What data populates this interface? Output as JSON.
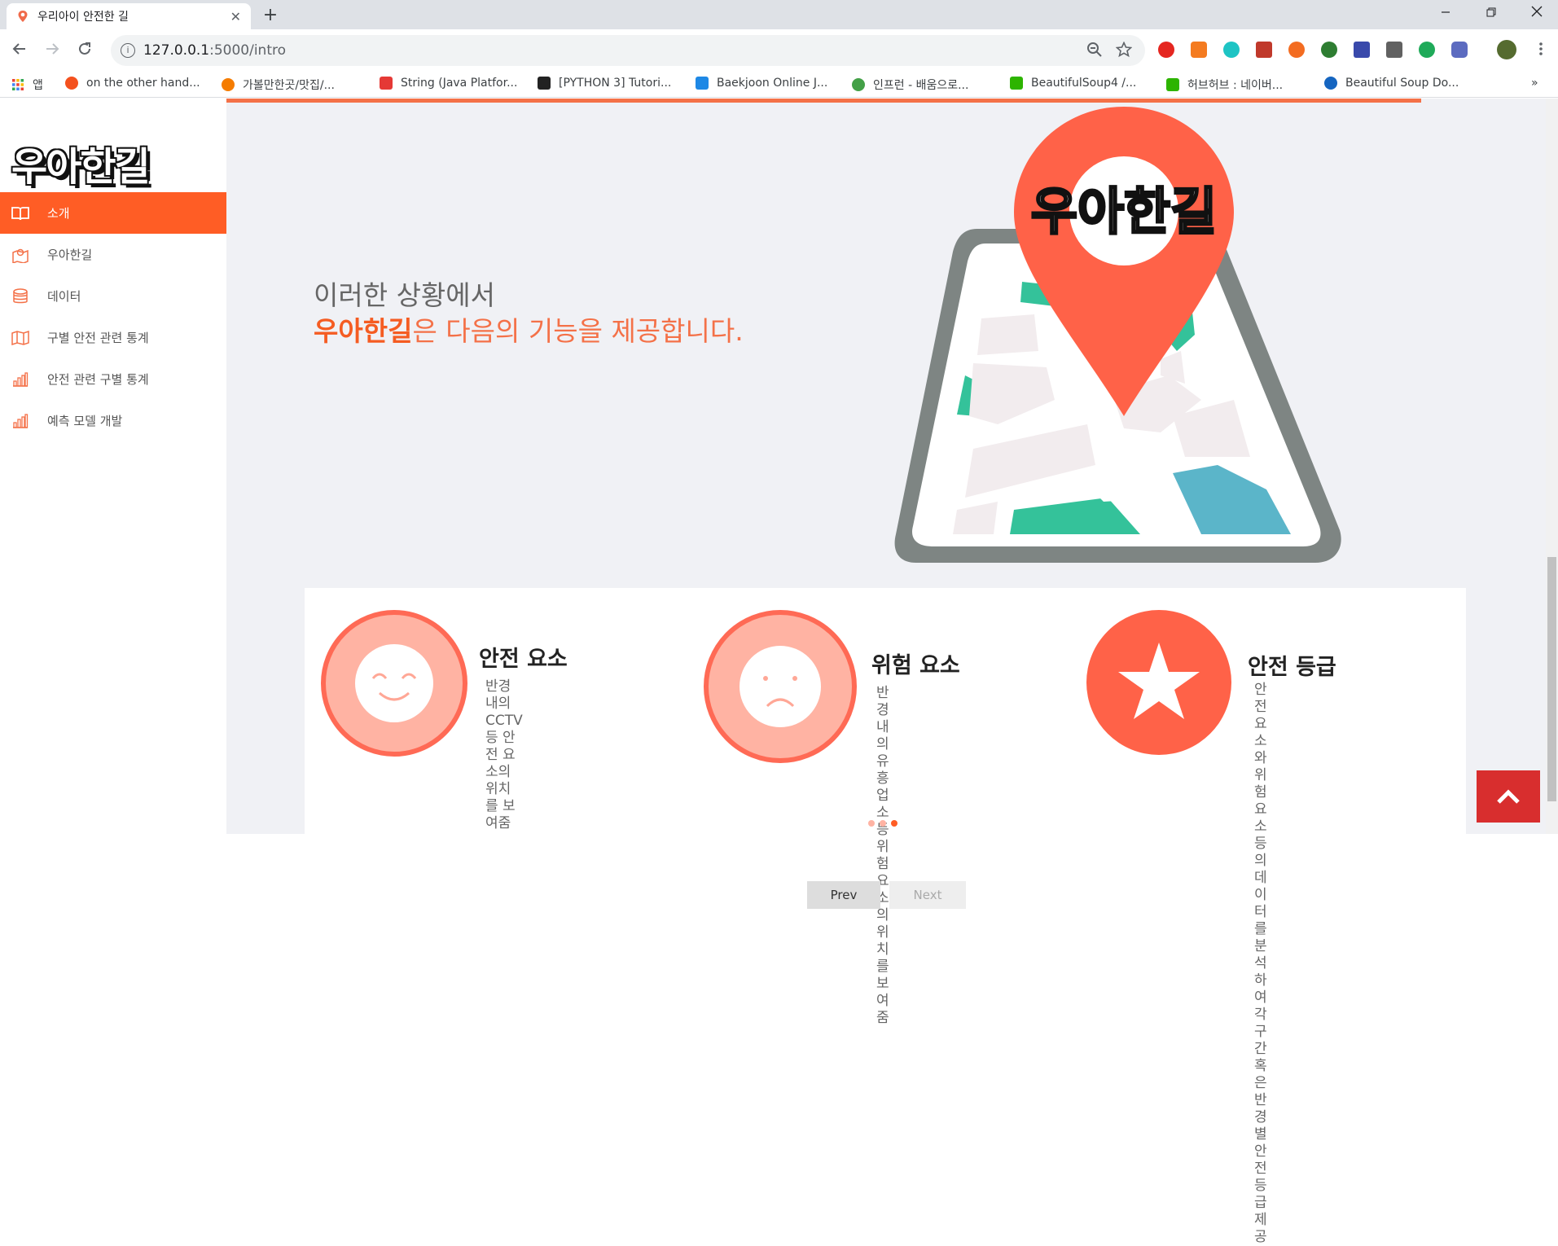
{
  "browser": {
    "tab_title": "우리아이 안전한 길",
    "tab_close": "✕",
    "new_tab": "+",
    "url_host": "127.0.0.1",
    "url_path": ":5000/intro",
    "bookmarks": [
      {
        "label": "앱",
        "color": "#ea4335"
      },
      {
        "label": "on the other hand...",
        "color": "#f4511e"
      },
      {
        "label": "가볼만한곳/맛집/...",
        "color": "#f57c00"
      },
      {
        "label": "String (Java Platfor...",
        "color": "#e53935"
      },
      {
        "label": "[PYTHON 3] Tutori...",
        "color": "#222222"
      },
      {
        "label": "Baekjoon Online J...",
        "color": "#1e88e5"
      },
      {
        "label": "인프런 - 배움으로...",
        "color": "#43a047"
      },
      {
        "label": "BeautifulSoup4 /...",
        "color": "#2db400"
      },
      {
        "label": "허브허브 : 네이버...",
        "color": "#2db400"
      },
      {
        "label": "Beautiful Soup Do...",
        "color": "#1565c0"
      }
    ],
    "more_bookmarks": "»"
  },
  "sidebar": {
    "logo": "우아한길",
    "items": [
      {
        "label": "소개",
        "icon": "book-open-icon",
        "active": true
      },
      {
        "label": "우아한길",
        "icon": "map-marker-icon",
        "active": false
      },
      {
        "label": "데이터",
        "icon": "database-icon",
        "active": false
      },
      {
        "label": "구별 안전 관련 통계",
        "icon": "map-icon",
        "active": false
      },
      {
        "label": "안전 관련 구별 통계",
        "icon": "bar-chart-icon",
        "active": false
      },
      {
        "label": "예측 모델 개발",
        "icon": "bar-chart-icon",
        "active": false
      }
    ]
  },
  "main": {
    "headline_line1": "이러한 상황에서",
    "headline_brand": "우아한길",
    "headline_rest": "은 다음의 기능을 제공합니다.",
    "map_logo": "우아한길",
    "features": [
      {
        "title": "안전 요소",
        "desc_line1": "반경 내의 CCTV 등 안전 요소의",
        "desc_line2": "위치를 보여줌",
        "icon": "smile-icon"
      },
      {
        "title": "위험 요소",
        "desc_line1": "반경 내의 유흥 업소 등 위험",
        "desc_line2": "요소의 위치를 보여줌",
        "icon": "sad-face-icon"
      },
      {
        "title": "안전 등급",
        "desc_line1": "안전 요소와 위험 요소 등의",
        "desc_line2": "데이터를 분석하여 각 구간 혹은",
        "desc_line3": "반경 별 안전 등급 제공",
        "icon": "star-icon"
      }
    ],
    "prev_label": "Prev",
    "next_label": "Next"
  },
  "colors": {
    "accent": "#ff5d25",
    "brand": "#f55c22",
    "scroll_top": "#d82e2e"
  }
}
